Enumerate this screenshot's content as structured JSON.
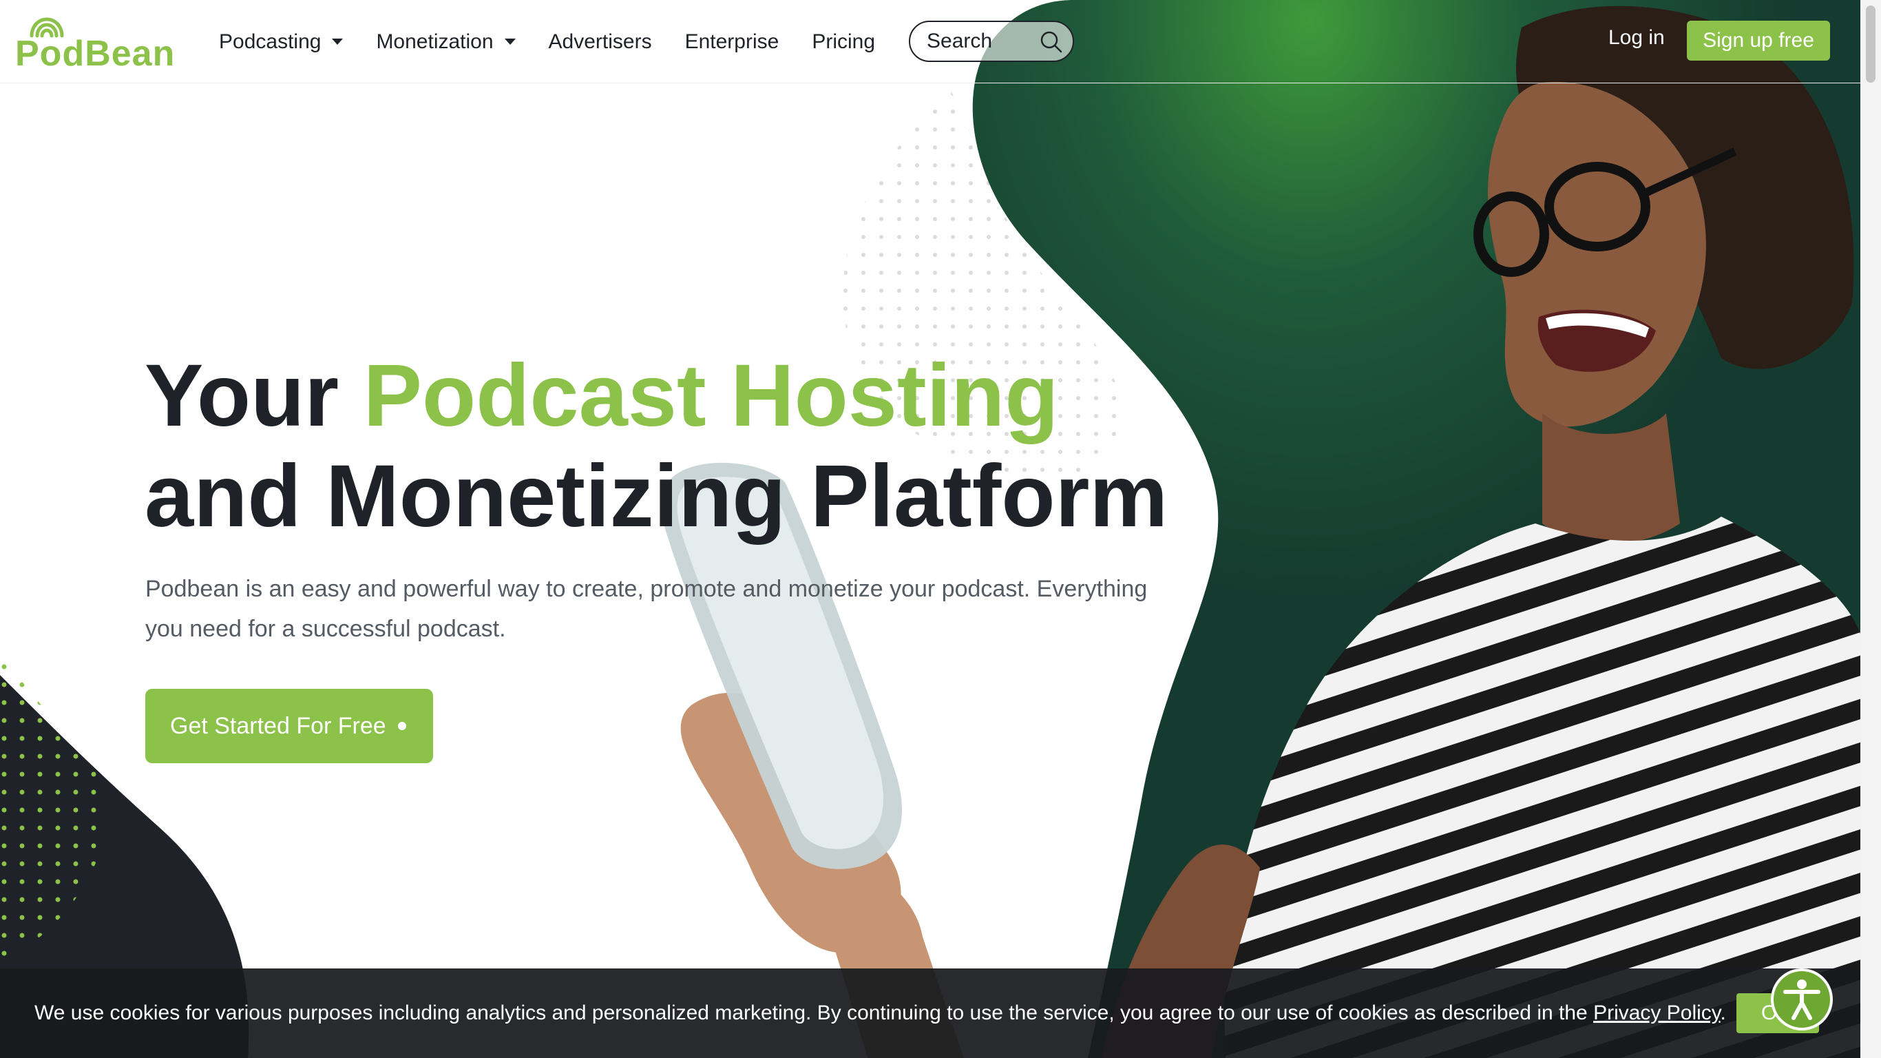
{
  "brand": {
    "logo_text": "PodBean",
    "accent_color": "#8cc24a",
    "dark_color": "#1f2228"
  },
  "nav": {
    "items": [
      {
        "label": "Podcasting",
        "has_dropdown": true
      },
      {
        "label": "Monetization",
        "has_dropdown": true
      },
      {
        "label": "Advertisers",
        "has_dropdown": false
      },
      {
        "label": "Enterprise",
        "has_dropdown": false
      },
      {
        "label": "Pricing",
        "has_dropdown": false
      }
    ],
    "search_placeholder": "Search",
    "login_label": "Log in",
    "signup_label": "Sign up free"
  },
  "hero": {
    "title_part1": "Your ",
    "title_accent": "Podcast Hosting",
    "title_line2": "and Monetizing Platform",
    "subtitle": "Podbean is an easy and powerful way to create, promote and monetize your podcast. Everything you need for a successful podcast.",
    "cta_label": "Get Started For Free"
  },
  "cookie_bar": {
    "text": "We use cookies for various purposes including analytics and personalized marketing. By continuing to use the service, you agree to our use of cookies as described in the ",
    "link_label": "Privacy Policy",
    "suffix": ".",
    "ok_label": "O"
  },
  "icons": {
    "search": "search-icon",
    "accessibility": "accessibility-icon",
    "dropdown": "chevron-down-icon"
  }
}
